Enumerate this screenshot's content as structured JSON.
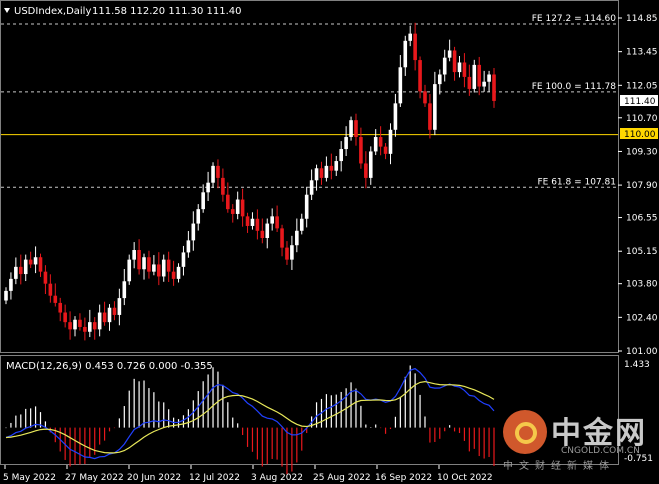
{
  "header": {
    "symbol": "USDIndex,Daily",
    "ohlc": "111.58 112.20 111.30 111.40"
  },
  "price_axis": {
    "ticks": [
      "114.85",
      "113.45",
      "112.05",
      "110.70",
      "109.30",
      "107.90",
      "106.55",
      "105.15",
      "103.80",
      "102.40",
      "101.00"
    ],
    "current_label": "111.40",
    "level_label": "110.00"
  },
  "fib_levels": [
    {
      "label": "FE 127.2 = 114.60",
      "value": 114.6
    },
    {
      "label": "FE 100.0 = 111.78",
      "value": 111.78
    },
    {
      "label": "FE 61.8 = 107.81",
      "value": 107.81
    }
  ],
  "horizontal_line": {
    "value": 110.0,
    "color": "#ffd700"
  },
  "macd": {
    "header": "MACD(12,26,9) 0.453 0.726 0.000 -0.355",
    "top_label": "1.433",
    "bottom_label": "-0.751"
  },
  "time_axis": {
    "labels": [
      "5 May 2022",
      "27 May 2022",
      "20 Jun 2022",
      "12 Jul 2022",
      "3 Aug 2022",
      "25 Aug 2022",
      "16 Sep 2022",
      "10 Oct 2022"
    ]
  },
  "watermark": {
    "title": "中金网",
    "site": "CNGOLD.COM.CN",
    "subtitle": "中文财经新媒体"
  },
  "colors": {
    "background": "#000000",
    "bull": "#ffffff",
    "bear": "#e8181c",
    "fib_line": "#c8c8c8",
    "level_line": "#ffd700",
    "macd_main": "#2040ff",
    "macd_signal": "#e8e85a"
  },
  "chart_data": [
    {
      "type": "candlestick",
      "title": "USDIndex,Daily",
      "ylim": [
        101.0,
        114.85
      ],
      "xlabel": "",
      "ylabel": "",
      "x_tick_labels": [
        "5 May 2022",
        "27 May 2022",
        "20 Jun 2022",
        "12 Jul 2022",
        "3 Aug 2022",
        "25 Aug 2022",
        "16 Sep 2022",
        "10 Oct 2022"
      ],
      "close_path": [
        103.5,
        104.0,
        104.5,
        104.2,
        104.8,
        104.6,
        104.9,
        104.3,
        103.8,
        103.3,
        103.0,
        102.6,
        102.2,
        101.9,
        102.3,
        102.0,
        101.8,
        102.2,
        101.9,
        102.6,
        102.2,
        102.8,
        102.5,
        103.2,
        103.9,
        104.8,
        105.2,
        104.4,
        104.9,
        104.3,
        104.6,
        104.1,
        104.8,
        104.3,
        104.0,
        104.5,
        105.1,
        105.6,
        106.3,
        106.9,
        107.6,
        108.0,
        108.7,
        108.2,
        107.5,
        106.9,
        106.7,
        107.3,
        106.6,
        106.2,
        106.5,
        106.0,
        105.7,
        106.3,
        106.6,
        106.1,
        105.3,
        104.8,
        105.4,
        106.0,
        106.5,
        107.5,
        108.1,
        108.6,
        108.2,
        108.7,
        108.5,
        108.9,
        109.4,
        109.9,
        110.6,
        109.9,
        108.8,
        108.2,
        109.3,
        109.9,
        109.5,
        109.2,
        110.2,
        111.3,
        112.8,
        113.9,
        114.2,
        113.1,
        111.8,
        111.3,
        110.2,
        112.1,
        112.5,
        113.2,
        113.5,
        112.6,
        113.0,
        112.4,
        111.9,
        112.9,
        112.0,
        112.2,
        112.5,
        111.4
      ],
      "macd_histogram_range": [
        -0.751,
        1.433
      ]
    }
  ]
}
